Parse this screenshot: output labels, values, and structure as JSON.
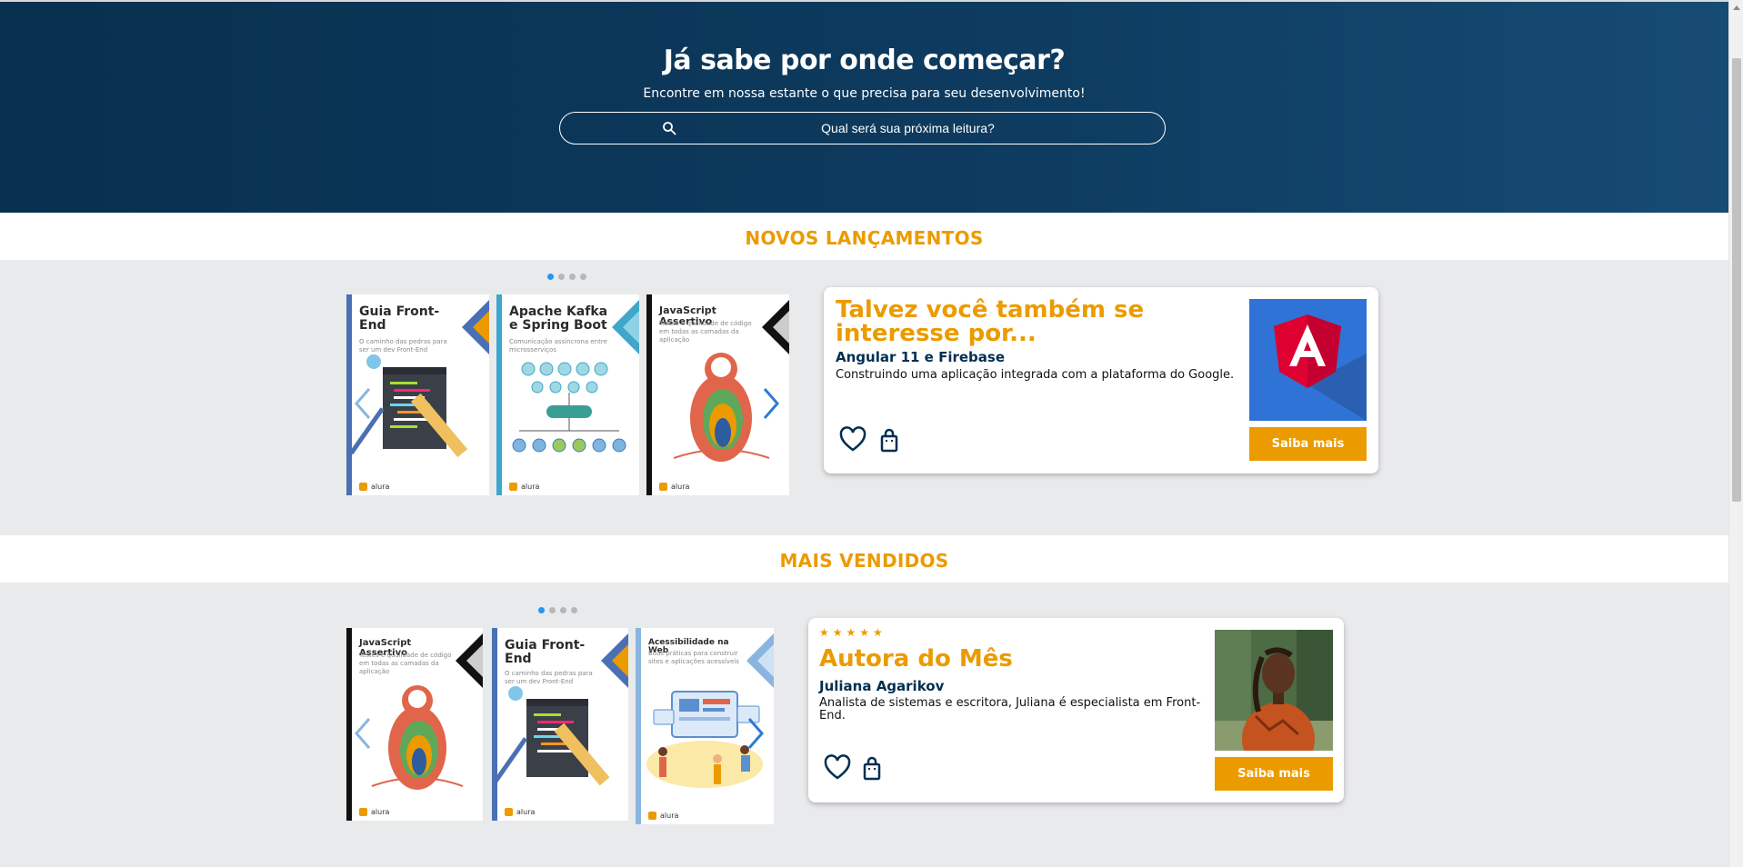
{
  "hero": {
    "title": "Já sabe por onde começar?",
    "subtitle": "Encontre em nossa estante o que precisa para seu desenvolvimento!",
    "search_placeholder": "Qual será sua próxima leitura?"
  },
  "novos": {
    "heading": "NOVOS LANÇAMENTOS",
    "pagination": {
      "total": 4,
      "active": 1
    },
    "books": [
      {
        "title": "Guia Front-End",
        "subtitle": "O caminho das pedras para ser um dev Front-End",
        "brand": "alura",
        "accent": "#4a6fb5"
      },
      {
        "title": "Apache Kafka e Spring Boot",
        "subtitle": "Comunicação assíncrona entre microsserviços",
        "brand": "alura",
        "accent": "#3fa7c9"
      },
      {
        "title": "JavaScript Assertivo",
        "subtitle": "Testes e qualidade de código em todas as camadas da aplicação",
        "brand": "alura",
        "accent": "#111111"
      }
    ],
    "card": {
      "title": "Talvez você também se interesse por...",
      "book_name": "Angular 11 e Firebase",
      "description": "Construindo uma aplicação integrada com a plataforma do Google.",
      "button": "Saiba mais",
      "image_icon": "angular-logo-icon"
    }
  },
  "mais": {
    "heading": "MAIS VENDIDOS",
    "pagination": {
      "total": 4,
      "active": 1
    },
    "books": [
      {
        "title": "JavaScript Assertivo",
        "subtitle": "Testes e qualidade de código em todas as camadas da aplicação",
        "brand": "alura",
        "accent": "#111111"
      },
      {
        "title": "Guia Front-End",
        "subtitle": "O caminho das pedras para ser um dev Front-End",
        "brand": "alura",
        "accent": "#4a6fb5"
      },
      {
        "title": "Acessibilidade na Web",
        "subtitle": "Boas práticas para construir sites e aplicações acessíveis",
        "brand": "alura",
        "accent": "#8ab5e0"
      }
    ],
    "card": {
      "rating": "★★★★★",
      "title": "Autora do Mês",
      "author_name": "Juliana Agarikov",
      "description": "Analista de sistemas e escritora, Juliana é especialista em Front-End.",
      "button": "Saiba mais"
    }
  },
  "colors": {
    "brand_orange": "#eb9b00",
    "brand_navy": "#002f52",
    "carousel_arrow": "#2b7cd3"
  }
}
